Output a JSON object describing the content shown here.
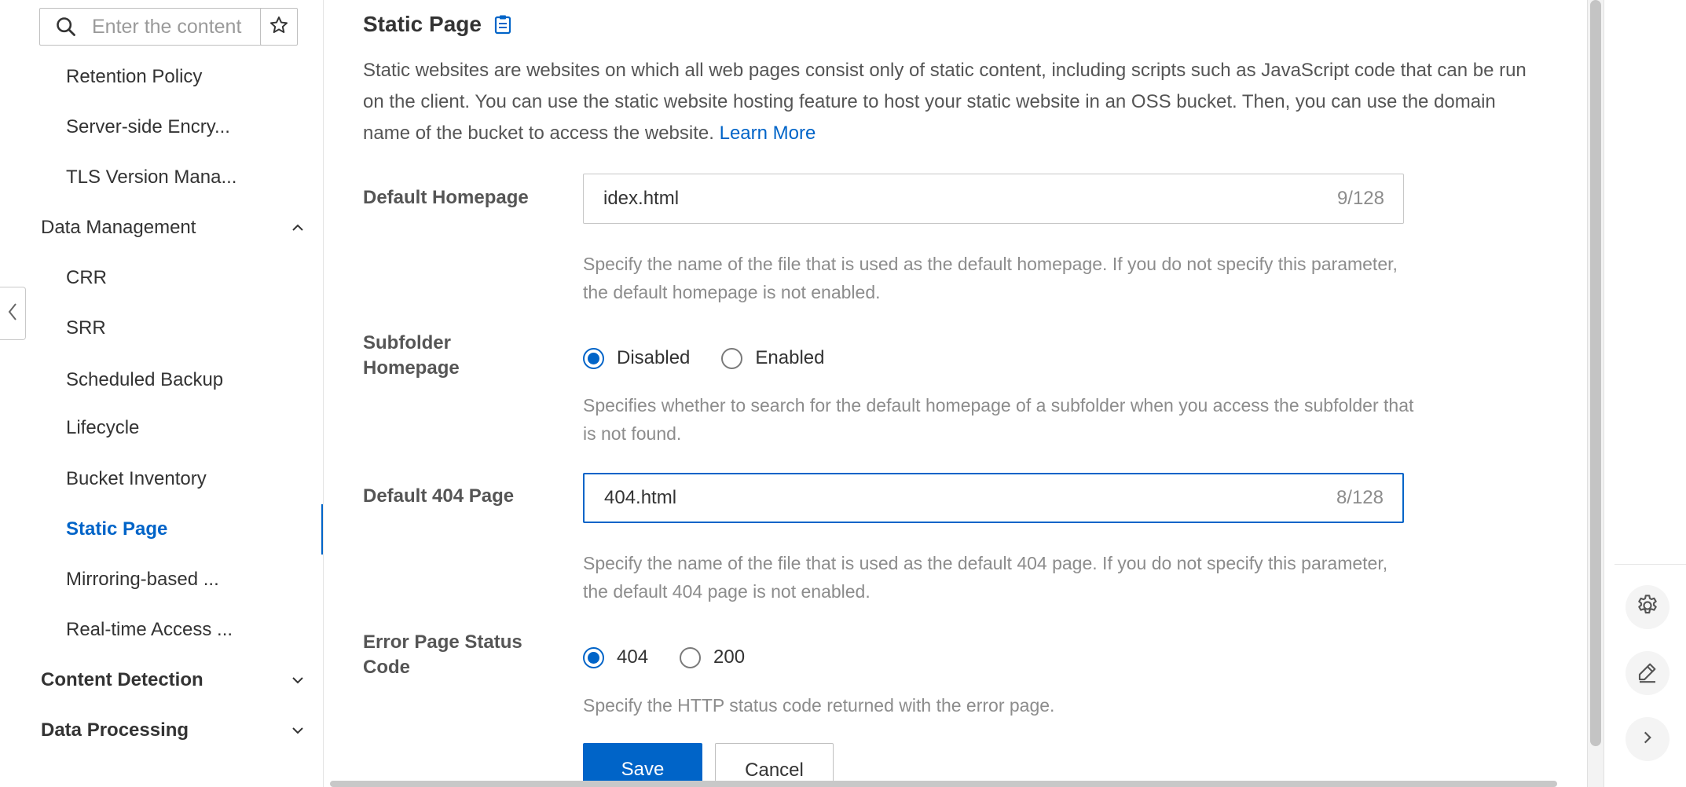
{
  "sidebar": {
    "search": {
      "placeholder": "Enter the content",
      "value": ""
    },
    "items": [
      {
        "label": "Retention Policy",
        "type": "item"
      },
      {
        "label": "Server-side Encry...",
        "type": "item"
      },
      {
        "label": "TLS Version Mana...",
        "type": "item"
      },
      {
        "label": "Data Management",
        "type": "group",
        "expanded": true
      },
      {
        "label": "CRR",
        "type": "item"
      },
      {
        "label": "SRR",
        "type": "item"
      },
      {
        "label": "Scheduled Backup",
        "type": "item"
      },
      {
        "label": "Lifecycle",
        "type": "item"
      },
      {
        "label": "Bucket Inventory",
        "type": "item"
      },
      {
        "label": "Static Page",
        "type": "item",
        "active": true
      },
      {
        "label": "Mirroring-based ...",
        "type": "item"
      },
      {
        "label": "Real-time Access ...",
        "type": "item"
      },
      {
        "label": "Content Detection",
        "type": "group",
        "expanded": false
      },
      {
        "label": "Data Processing",
        "type": "group",
        "expanded": false
      }
    ]
  },
  "page": {
    "title": "Static Page",
    "description": "Static websites are websites on which all web pages consist only of static content, including scripts such as JavaScript code that can be run on the client. You can use the static website hosting feature to host your static website in an OSS bucket. Then, you can use the domain name of the bucket to access the website.",
    "learn_more": "Learn More"
  },
  "form": {
    "default_homepage": {
      "label": "Default Homepage",
      "value": "idex.html",
      "count": "9/128",
      "help": "Specify the name of the file that is used as the default homepage. If you do not specify this parameter, the default homepage is not enabled."
    },
    "subfolder_homepage": {
      "label": "Subfolder Homepage",
      "options": [
        "Disabled",
        "Enabled"
      ],
      "selected": "Disabled",
      "help": "Specifies whether to search for the default homepage of a subfolder when you access the subfolder that is not found."
    },
    "default_404": {
      "label": "Default 404 Page",
      "value": "404.html",
      "count": "8/128",
      "help": "Specify the name of the file that is used as the default 404 page. If you do not specify this parameter, the default 404 page is not enabled."
    },
    "error_status": {
      "label": "Error Page Status Code",
      "options": [
        "404",
        "200"
      ],
      "selected": "404",
      "help": "Specify the HTTP status code returned with the error page."
    },
    "save_label": "Save",
    "cancel_label": "Cancel"
  },
  "icons": {
    "search": "search-icon",
    "star": "star-icon",
    "copy": "clipboard-icon",
    "settings": "gear-icon",
    "edit": "pencil-icon",
    "expand": "chevron-right-icon",
    "collapse": "chevron-left-icon"
  },
  "colors": {
    "accent": "#0064c8",
    "text": "#333333",
    "muted": "#8c8c8c"
  }
}
